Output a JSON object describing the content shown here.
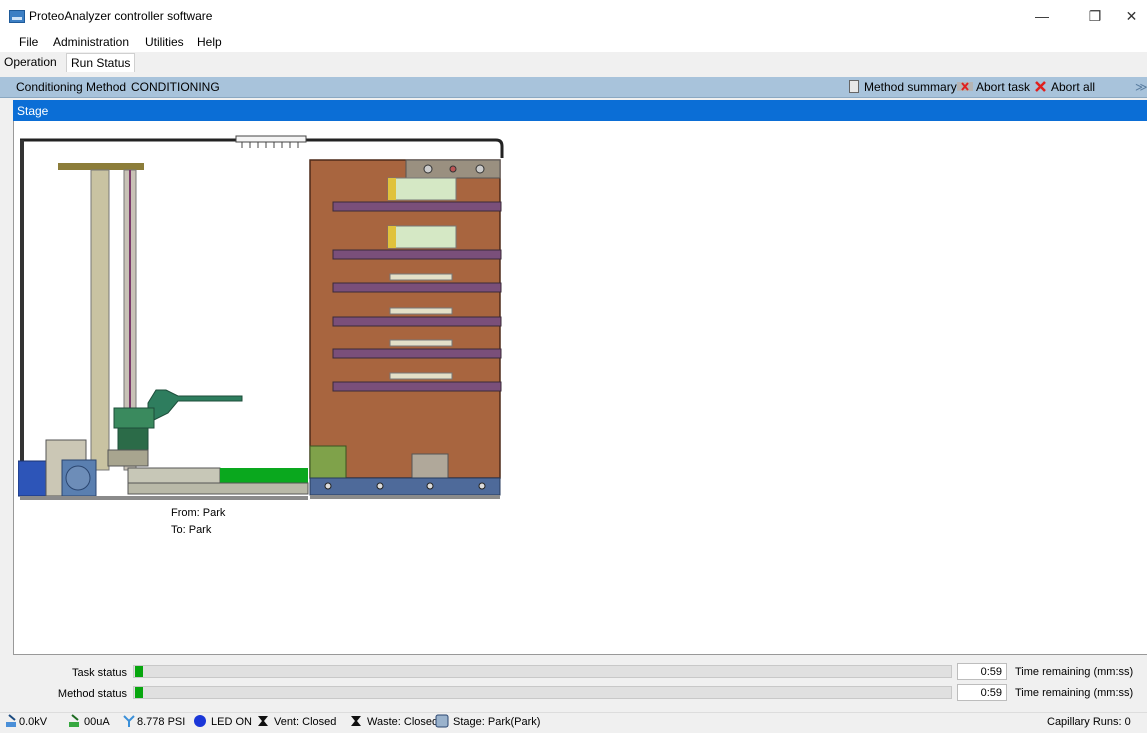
{
  "window": {
    "title": "ProteoAnalyzer controller software",
    "minimize_glyph": "—",
    "restore_glyph": "❐",
    "close_glyph": "✕"
  },
  "menu": [
    "File",
    "Administration",
    "Utilities",
    "Help"
  ],
  "tabs": [
    "Operation",
    "Run Status"
  ],
  "method_bar": {
    "label": "Conditioning Method",
    "value": "CONDITIONING",
    "summary": "Method summary",
    "abort_task": "Abort task",
    "abort_all": "Abort all",
    "collapse_glyph": "≫"
  },
  "stage": {
    "header": "Stage",
    "from": "From: Park",
    "to": "To: Park"
  },
  "task_status": {
    "label": "Task status",
    "progress": 0.01,
    "time": "0:59",
    "time_label": "Time remaining (mm:ss)"
  },
  "method_status": {
    "label": "Method status",
    "progress": 0.01,
    "time": "0:59",
    "time_label": "Time remaining (mm:ss)"
  },
  "statusbar": {
    "voltage": "0.0kV",
    "current": "00uA",
    "pressure": "8.778 PSI",
    "led": "LED ON",
    "vent": "Vent: Closed",
    "waste": "Waste: Closed",
    "stage": "Stage: Park(Park)",
    "capillary": "Capillary Runs: 0"
  },
  "colors": {
    "accent": "#0b6ed6",
    "method_bar": "#a8c3db",
    "progress": "#07a60e",
    "led": "#1a36d8"
  },
  "icons": [
    "app-icon",
    "method-summary-icon",
    "abort-task-icon",
    "abort-all-icon",
    "voltage-icon",
    "current-icon",
    "pressure-icon",
    "led-icon",
    "vent-icon",
    "waste-icon",
    "stage-icon"
  ]
}
